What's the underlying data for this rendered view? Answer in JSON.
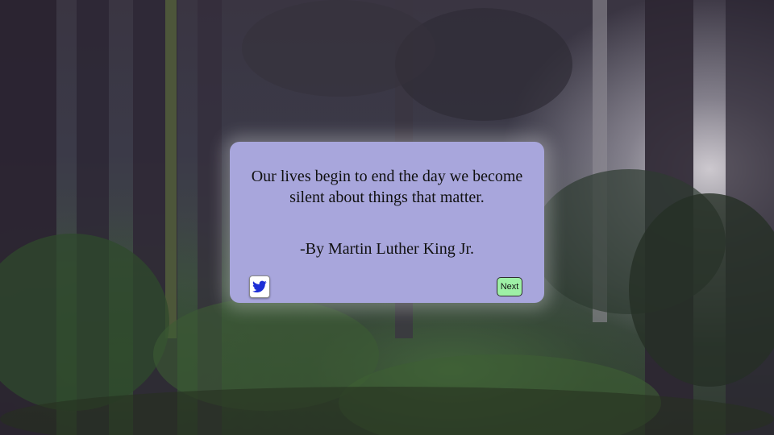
{
  "quote": {
    "text": "Our lives begin to end the day we become silent about things that matter.",
    "author": "-By Martin Luther King Jr."
  },
  "actions": {
    "tweet_icon": "twitter-bird",
    "next_label": "Next"
  },
  "colors": {
    "card_background": "#a8a6dc",
    "next_button": "#9ef0a6",
    "twitter_blue": "#1d2fd6"
  }
}
